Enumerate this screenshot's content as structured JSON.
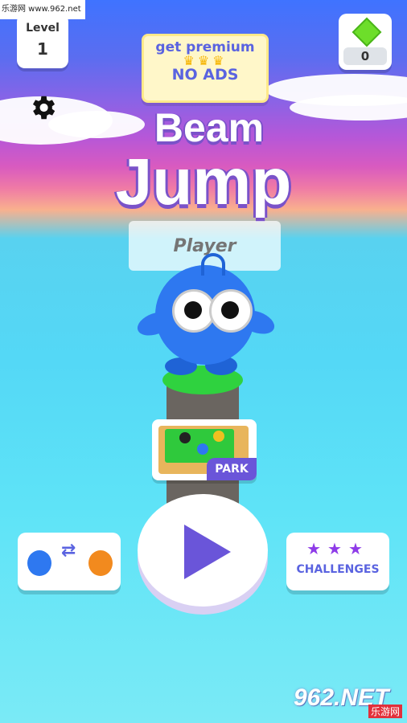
{
  "watermark_top": "乐游网 www.962.net",
  "hud": {
    "level_label": "Level",
    "level_value": "1",
    "gem_count": "0"
  },
  "premium": {
    "line1": "get premium",
    "line2": "NO ADS"
  },
  "title": {
    "word1": "Beam",
    "word2": "Jump"
  },
  "player_name": {
    "placeholder": "Player"
  },
  "park": {
    "label": "PARK"
  },
  "buttons": {
    "challenges_label": "CHALLENGES"
  },
  "colors": {
    "accent": "#5a63e0",
    "play": "#6a55d9",
    "gem": "#6dde2a",
    "character": "#2e78f0"
  },
  "icons": {
    "settings": "gear-icon",
    "play": "play-icon",
    "swap": "swap-arrows-icon",
    "stars": "star-icon",
    "gem": "gem-icon"
  },
  "logo_bottom": {
    "main": "962.NET",
    "sub": "乐游网"
  }
}
